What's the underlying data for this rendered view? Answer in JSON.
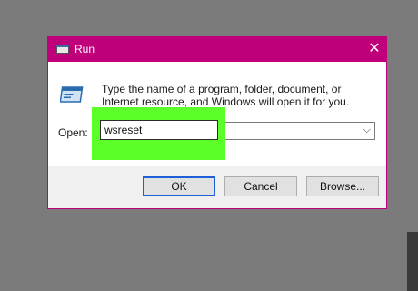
{
  "window": {
    "title": "Run",
    "close_glyph": "✕",
    "title_icon": "run-app-icon"
  },
  "description": "Type the name of a program, folder, document, or Internet resource, and Windows will open it for you.",
  "open_field": {
    "label": "Open:",
    "value": "wsreset",
    "dropdown_glyph": "⌵"
  },
  "buttons": {
    "ok": "OK",
    "cancel": "Cancel",
    "browse": "Browse..."
  },
  "colors": {
    "titlebar": "#c0007a",
    "highlight": "#5cff27",
    "backdrop": "#7b7b7b"
  }
}
